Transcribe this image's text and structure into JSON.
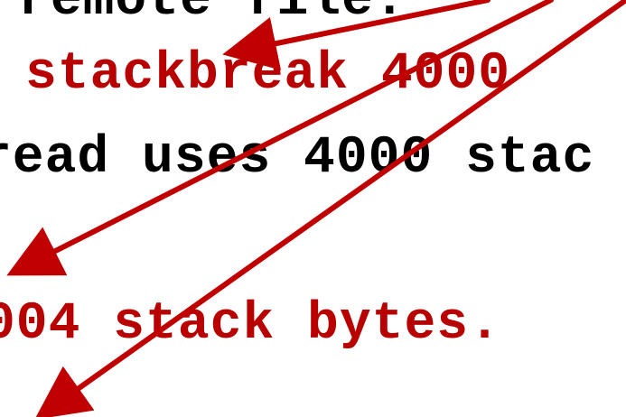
{
  "lines": {
    "line1": "remote file.",
    "line2": "stackbreak 4000",
    "line3": "read uses 4000 stac",
    "line4": "004 stack bytes."
  },
  "colors": {
    "text_black": "#000000",
    "text_red": "#b80000",
    "arrow_red": "#c00000"
  },
  "arrows": [
    "arrow-icon",
    "arrow-icon",
    "arrow-icon"
  ]
}
